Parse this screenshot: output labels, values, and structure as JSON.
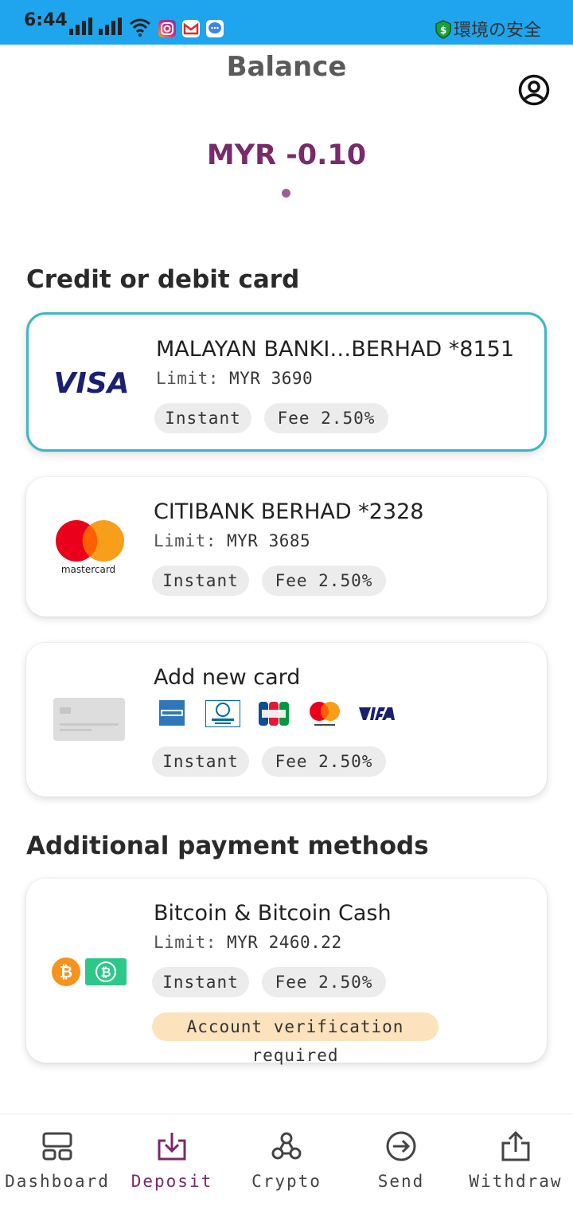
{
  "status_bar": {
    "time": "6:44",
    "env_label": "環境の安全",
    "icons": [
      "signal-icon",
      "signal-icon",
      "wifi-icon",
      "instagram-icon",
      "gmail-icon",
      "messenger-icon",
      "shield-icon"
    ]
  },
  "header": {
    "title": "Balance",
    "balance": "MYR -0.10"
  },
  "sections": {
    "cards_heading": "Credit or debit card",
    "additional_heading": "Additional payment methods"
  },
  "cards": [
    {
      "brand": "VISA",
      "title": "MALAYAN BANKI…BERHAD *8151",
      "limit_label": "Limit:",
      "limit_value": "MYR 3690",
      "pill_speed": "Instant",
      "pill_fee": "Fee 2.50%",
      "selected": true
    },
    {
      "brand": "mastercard",
      "title": "CITIBANK BERHAD *2328",
      "limit_label": "Limit:",
      "limit_value": "MYR 3685",
      "pill_speed": "Instant",
      "pill_fee": "Fee 2.50%",
      "selected": false
    },
    {
      "brand": "generic-card",
      "title": "Add new card",
      "network_icons": [
        "amex-icon",
        "diners-club-icon",
        "jcb-icon",
        "mastercard-icon",
        "visa-icon"
      ],
      "pill_speed": "Instant",
      "pill_fee": "Fee 2.50%"
    }
  ],
  "additional": [
    {
      "title": "Bitcoin & Bitcoin Cash",
      "limit_label": "Limit:",
      "limit_value": "MYR 2460.22",
      "pill_speed": "Instant",
      "pill_fee": "Fee 2.50%",
      "warning": "Account verification required"
    }
  ],
  "nav": {
    "items": [
      {
        "label": "Dashboard",
        "icon": "dashboard-icon"
      },
      {
        "label": "Deposit",
        "icon": "deposit-icon",
        "active": true
      },
      {
        "label": "Crypto",
        "icon": "crypto-icon"
      },
      {
        "label": "Send",
        "icon": "send-icon"
      },
      {
        "label": "Withdraw",
        "icon": "withdraw-icon"
      }
    ]
  },
  "colors": {
    "accent": "#782a6b",
    "selected_border": "#3bb8c3",
    "statusbar": "#1ea5ee",
    "warning_pill": "#fde3bd"
  }
}
